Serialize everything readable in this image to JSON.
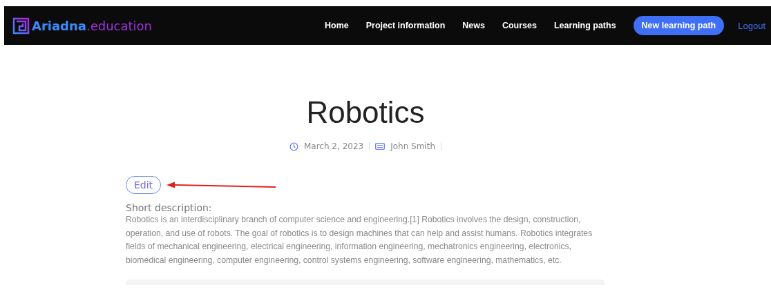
{
  "logo": {
    "name": "Ariadna",
    "suffix": ".education"
  },
  "nav": [
    {
      "label": "Home",
      "kind": "link"
    },
    {
      "label": "Project information",
      "kind": "link"
    },
    {
      "label": "News",
      "kind": "link"
    },
    {
      "label": "Courses",
      "kind": "link"
    },
    {
      "label": "Learning paths",
      "kind": "link"
    },
    {
      "label": "New learning path",
      "kind": "button"
    },
    {
      "label": "Logout",
      "kind": "accent"
    }
  ],
  "title": "Robotics",
  "meta": {
    "date": "March 2, 2023",
    "author": "John Smith"
  },
  "edit_button": "Edit",
  "description": {
    "heading": "Short description:",
    "text": "Robotics is an interdisciplinary branch of computer science and engineering.[1] Robotics involves the design, construction, operation, and use of robots. The goal of robotics is to design machines that can help and assist humans. Robotics integrates fields of mechanical engineering, electrical engineering, information engineering, mechatronics engineering, electronics, biomedical engineering, computer engineering, control systems engineering, software engineering, mathematics, etc."
  }
}
